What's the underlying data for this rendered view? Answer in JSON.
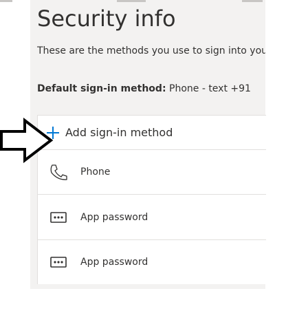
{
  "page": {
    "title": "Security info",
    "description": "These are the methods you use to sign into your account or reset your password.",
    "default_method_label": "Default sign-in method:",
    "default_method_value": " Phone - text +91"
  },
  "add_method": {
    "label": "Add sign-in method"
  },
  "methods": [
    {
      "label": "Phone",
      "icon": "phone-icon"
    },
    {
      "label": "App password",
      "icon": "app-password-icon"
    },
    {
      "label": "App password",
      "icon": "app-password-icon"
    }
  ],
  "colors": {
    "accent": "#0078d4",
    "panel": "#f3f2f1",
    "text": "#323130"
  }
}
